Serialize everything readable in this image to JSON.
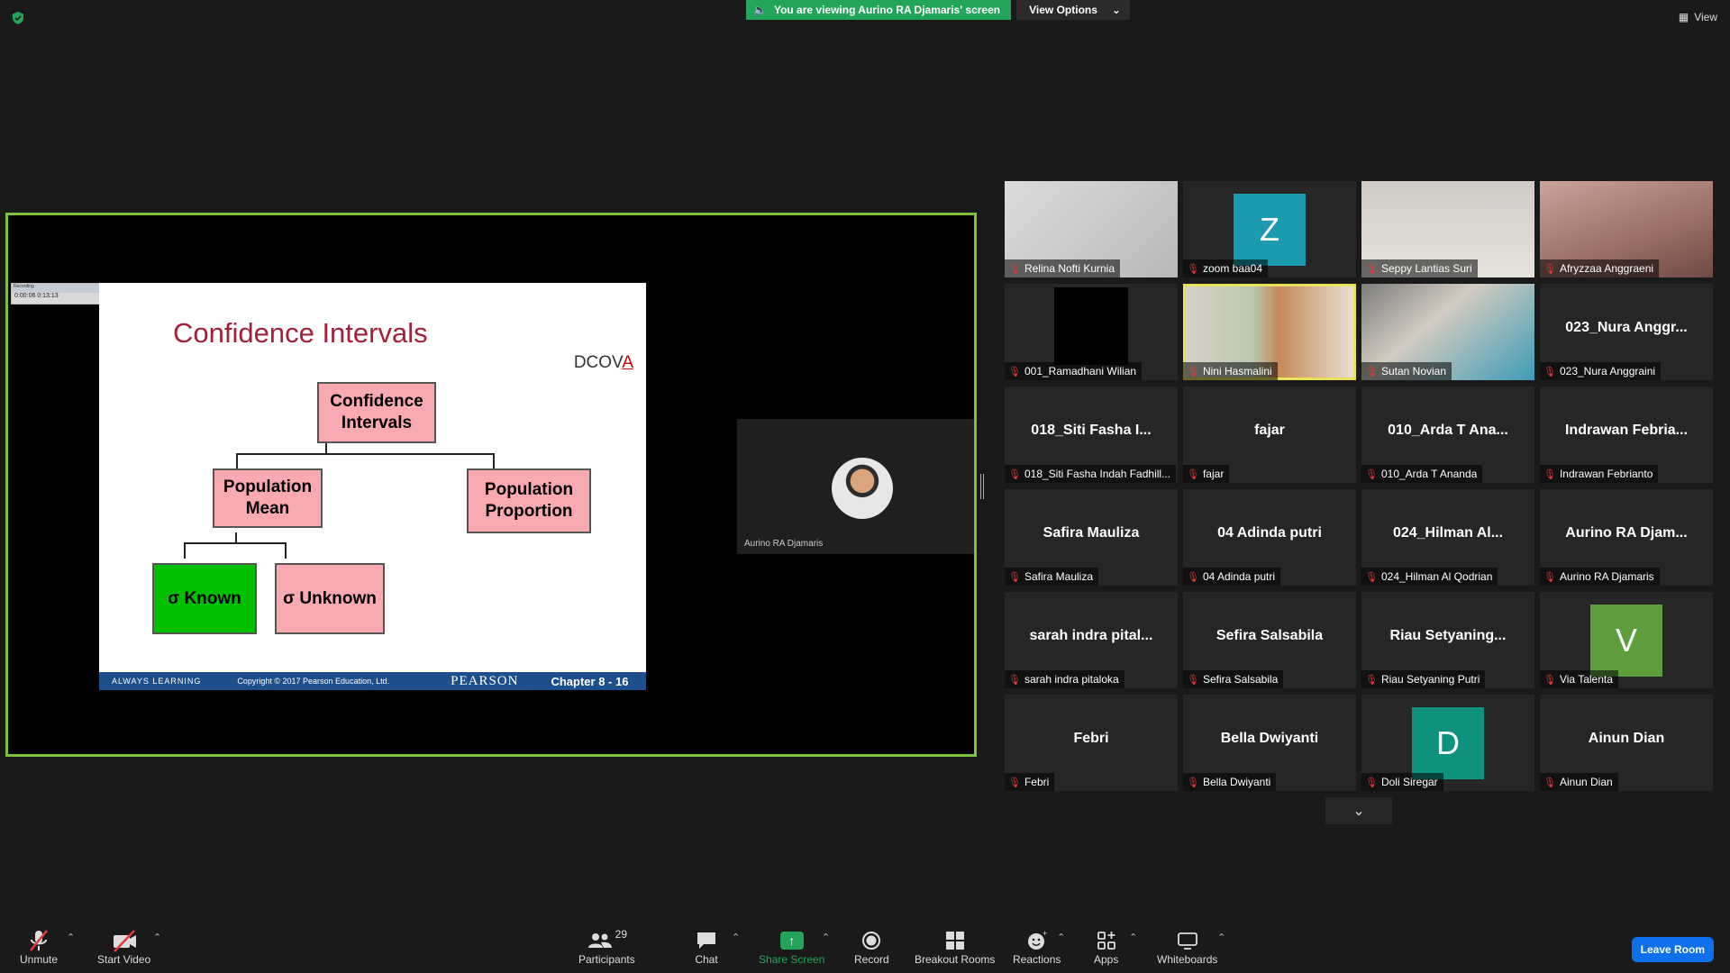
{
  "banner": {
    "viewing_text": "You are viewing Aurino RA Djamaris' screen",
    "view_options": "View Options"
  },
  "top_right": {
    "view_label": "View"
  },
  "slide": {
    "title": "Confidence Intervals",
    "logo_prefix": "DCOV",
    "logo_suffix": "A",
    "recorder_title": "Recording",
    "recorder_time": "0:00:06  0:13:13",
    "boxes": {
      "root": "Confidence Intervals",
      "mean": "Population Mean",
      "proportion": "Population Proportion",
      "known": "σ Known",
      "unknown": "σ Unknown"
    },
    "footer": {
      "always": "ALWAYS LEARNING",
      "copyright": "Copyright © 2017 Pearson Education, Ltd.",
      "publisher": "PEARSON",
      "chapter": "Chapter 8 - 16"
    }
  },
  "presenter": {
    "name": "Aurino RA Djamaris"
  },
  "participants": [
    {
      "center": "",
      "label": "Relina Nofti Kurnia",
      "kind": "photo0"
    },
    {
      "center": "Z",
      "label": "zoom baa04",
      "kind": "avatar",
      "color": "#1b9bb0"
    },
    {
      "center": "",
      "label": "Seppy Lantias Suri",
      "kind": "photo2"
    },
    {
      "center": "",
      "label": "Afryzzaa Anggraeni",
      "kind": "photo3"
    },
    {
      "center": "",
      "label": "001_Ramadhani Wilian",
      "kind": "black"
    },
    {
      "center": "",
      "label": "Nini Hasmalini",
      "kind": "photo5",
      "active": true
    },
    {
      "center": "",
      "label": "Sutan Novian",
      "kind": "photo6"
    },
    {
      "center": "023_Nura  Anggr...",
      "label": "023_Nura Anggraini",
      "kind": "name"
    },
    {
      "center": "018_Siti Fasha I...",
      "label": "018_Siti Fasha Indah Fadhill...",
      "kind": "name"
    },
    {
      "center": "fajar",
      "label": "fajar",
      "kind": "name"
    },
    {
      "center": "010_Arda T Ana...",
      "label": "010_Arda T Ananda",
      "kind": "name"
    },
    {
      "center": "Indrawan  Febria...",
      "label": "Indrawan Febrianto",
      "kind": "name"
    },
    {
      "center": "Safira Mauliza",
      "label": "Safira Mauliza",
      "kind": "name"
    },
    {
      "center": "04 Adinda putri",
      "label": "04 Adinda putri",
      "kind": "name"
    },
    {
      "center": "024_Hilman Al...",
      "label": "024_Hilman Al Qodrian",
      "kind": "name"
    },
    {
      "center": "Aurino  RA  Djam...",
      "label": "Aurino RA Djamaris",
      "kind": "name"
    },
    {
      "center": "sarah  indra  pital...",
      "label": "sarah indra pitaloka",
      "kind": "name"
    },
    {
      "center": "Sefira Salsabila",
      "label": "Sefira Salsabila",
      "kind": "name"
    },
    {
      "center": "Riau  Setyaning...",
      "label": "Riau Setyaning Putri",
      "kind": "name"
    },
    {
      "center": "V",
      "label": "Via Talenta",
      "kind": "avatar",
      "color": "#5e9f3c"
    },
    {
      "center": "Febri",
      "label": "Febri",
      "kind": "name"
    },
    {
      "center": "Bella Dwiyanti",
      "label": "Bella Dwiyanti",
      "kind": "name"
    },
    {
      "center": "D",
      "label": "Doli Siregar",
      "kind": "avatar",
      "color": "#0f9180"
    },
    {
      "center": "Ainun Dian",
      "label": "Ainun Dian",
      "kind": "name"
    }
  ],
  "toolbar": {
    "unmute": "Unmute",
    "start_video": "Start Video",
    "participants_count": "29",
    "participants": "Participants",
    "chat": "Chat",
    "share_screen": "Share Screen",
    "record": "Record",
    "breakout_rooms": "Breakout Rooms",
    "reactions": "Reactions",
    "apps": "Apps",
    "whiteboards": "Whiteboards",
    "leave_room": "Leave Room"
  }
}
